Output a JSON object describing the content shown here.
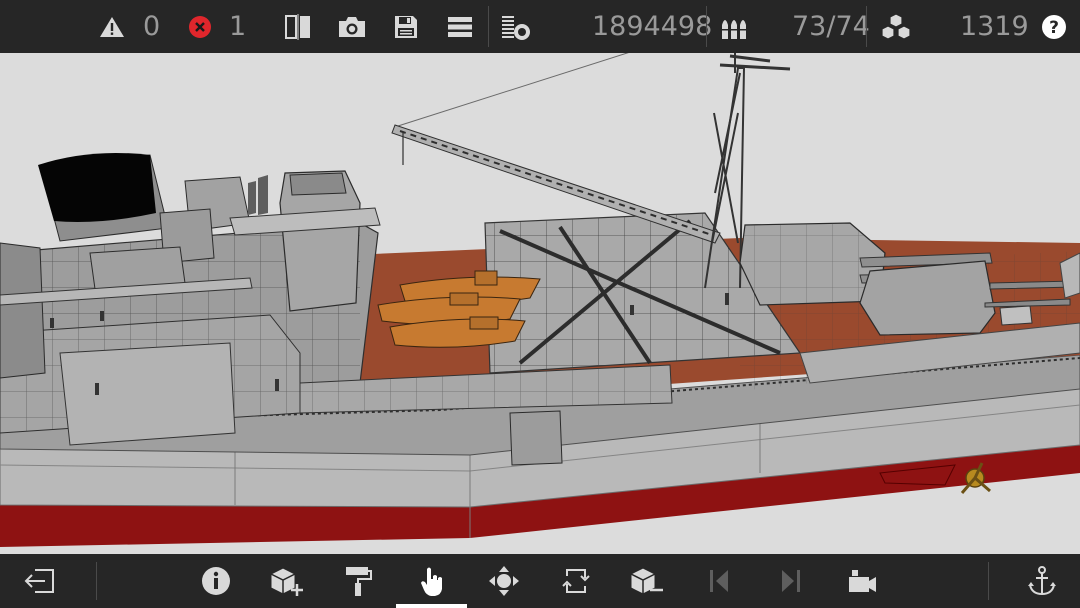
{
  "status": {
    "warnings_count": "0",
    "errors_count": "1",
    "part_count": "1894498",
    "ammo": "73/74",
    "blocks": "1319"
  },
  "icons": {
    "warning": "warning-icon",
    "error": "error-icon",
    "mirror": "mirror-icon",
    "camera": "camera-icon",
    "save": "save-icon",
    "menu": "menu-icon",
    "parts": "parts-icon",
    "ammo": "ammo-icon",
    "blocks": "blocks-icon",
    "help": "help-icon",
    "exit": "exit-icon",
    "info": "info-icon",
    "add_block": "add-block-icon",
    "paint": "paint-roller-icon",
    "select": "hand-pointer-icon",
    "move": "move-icon",
    "rotate": "rotate-icon",
    "remove_block": "remove-block-icon",
    "previous": "previous-icon",
    "next": "next-icon",
    "camera_view": "camera-view-icon",
    "anchor": "anchor-icon"
  },
  "colors": {
    "toolbar_bg": "#262626",
    "icon": "#d9d9d9",
    "text_dim": "#9a9a9a",
    "error_red": "#e0262c",
    "hull_red": "#8e1212",
    "deck_wood": "#9a4a2e",
    "viewport_bg": "#dcdcdc"
  },
  "bottom_toolbar": {
    "active_tool": "select"
  }
}
